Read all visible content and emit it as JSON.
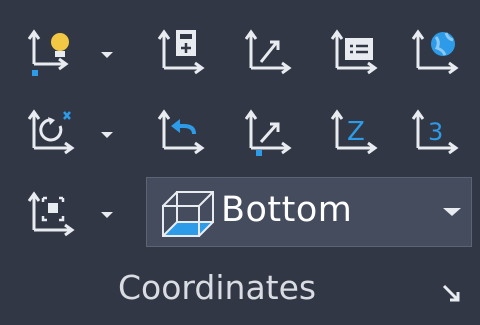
{
  "panel": {
    "title": "Coordinates",
    "launcher_icon": "dialog-launcher-arrow-icon"
  },
  "toolbar_row1": [
    {
      "name": "ucs-world-light-icon",
      "has_dropdown": true
    },
    {
      "name": "ucs-named-icon"
    },
    {
      "name": "ucs-object-icon"
    },
    {
      "name": "ucs-details-icon"
    },
    {
      "name": "ucs-world-icon"
    }
  ],
  "toolbar_row2": [
    {
      "name": "ucs-rotate-x-icon",
      "has_dropdown": true
    },
    {
      "name": "ucs-previous-icon"
    },
    {
      "name": "ucs-view-icon"
    },
    {
      "name": "ucs-z-axis-icon",
      "glyph": "Z"
    },
    {
      "name": "ucs-3point-icon",
      "glyph": "3"
    }
  ],
  "toolbar_row3": [
    {
      "name": "ucs-face-icon",
      "has_dropdown": true
    }
  ],
  "view_select": {
    "value": "Bottom",
    "icon": "view-cube-bottom-icon"
  },
  "colors": {
    "background": "#313744",
    "icon_white": "#e8ebf0",
    "accent_blue": "#2e9be8",
    "bulb_yellow": "#f2c744",
    "select_bg": "#444c5d"
  }
}
